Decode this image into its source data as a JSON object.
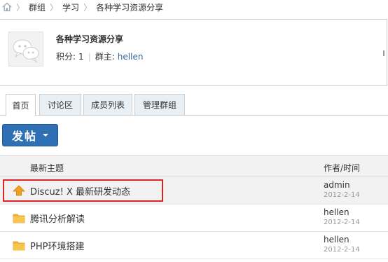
{
  "breadcrumb": {
    "items": [
      "群组",
      "学习",
      "各种学习资源分享"
    ]
  },
  "group": {
    "name": "各种学习资源分享",
    "points_label": "积分:",
    "points_value": "1",
    "owner_label": "群主:",
    "owner_name": "hellen"
  },
  "tabs": [
    {
      "label": "首页",
      "active": true
    },
    {
      "label": "讨论区",
      "active": false
    },
    {
      "label": "成员列表",
      "active": false
    },
    {
      "label": "管理群组",
      "active": false
    }
  ],
  "post_button": {
    "label": "发帖"
  },
  "thread_table": {
    "header_topic": "最新主题",
    "header_author": "作者/时间",
    "rows": [
      {
        "title": "Discuz! X 最新研发动态",
        "author": "admin",
        "date": "2012-2-14",
        "icon": "pinned-arrow-icon",
        "highlighted": true
      },
      {
        "title": "腾讯分析解读",
        "author": "hellen",
        "date": "2012-2-14",
        "icon": "folder-icon",
        "highlighted": false
      },
      {
        "title": "PHP环境搭建",
        "author": "hellen",
        "date": "2012-2-14",
        "icon": "folder-icon",
        "highlighted": false
      }
    ]
  },
  "colors": {
    "accent": "#2f6fb3",
    "link": "#336699",
    "highlight_frame": "#e02424",
    "folder": "#f2b53a",
    "pinned": "#f0a21e"
  }
}
